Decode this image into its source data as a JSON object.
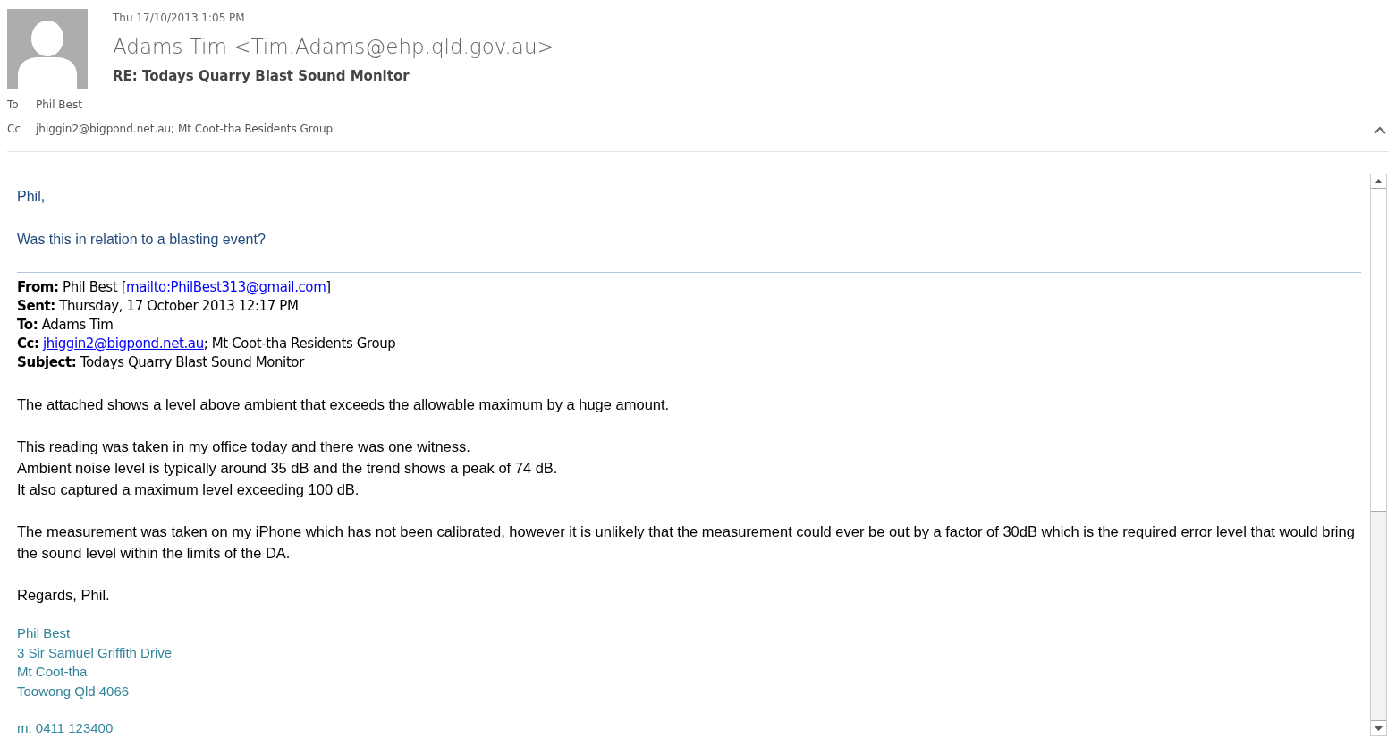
{
  "header": {
    "date": "Thu 17/10/2013 1:05 PM",
    "sender": "Adams Tim <Tim.Adams@ehp.qld.gov.au>",
    "subject": "RE: Todays Quarry Blast Sound Monitor",
    "recipients": [
      {
        "label": "To",
        "value": "Phil Best"
      },
      {
        "label": "Cc",
        "value": "jhiggin2@bigpond.net.au; Mt Coot-tha Residents Group"
      }
    ]
  },
  "reply": [
    "Phil,",
    "Was this in relation to a blasting event?"
  ],
  "quoted_header": [
    {
      "label": "From:",
      "parts": [
        {
          "kind": "text",
          "text": "Phil Best ["
        },
        {
          "kind": "link",
          "text": "mailto:PhilBest313@gmail.com"
        },
        {
          "kind": "text",
          "text": "]"
        }
      ]
    },
    {
      "label": "Sent:",
      "parts": [
        {
          "kind": "text",
          "text": "Thursday, 17 October 2013 12:17 PM"
        }
      ]
    },
    {
      "label": "To:",
      "parts": [
        {
          "kind": "text",
          "text": "Adams Tim"
        }
      ]
    },
    {
      "label": "Cc:",
      "parts": [
        {
          "kind": "link",
          "text": "jhiggin2@bigpond.net.au"
        },
        {
          "kind": "text",
          "text": "; Mt Coot-tha Residents Group"
        }
      ]
    },
    {
      "label": "Subject:",
      "parts": [
        {
          "kind": "text",
          "text": "Todays Quarry Blast Sound Monitor"
        }
      ]
    }
  ],
  "quoted_body": [
    [
      "The attached shows a level above ambient that exceeds the allowable maximum by a huge amount."
    ],
    [
      "This reading was taken in my office today and there was one witness.",
      "Ambient noise level is typically around 35 dB and the trend shows a peak of 74 dB.",
      "It also captured a maximum level exceeding 100 dB."
    ],
    [
      "The measurement was taken on my iPhone which has not been calibrated, however it is unlikely that the measurement could ever be out by a factor of 30dB which is the required error level that would bring the sound level within the limits of the DA."
    ],
    [
      "Regards, Phil."
    ]
  ],
  "signature": [
    [
      "Phil Best",
      "3 Sir Samuel Griffith Drive",
      "Mt Coot-tha",
      "Toowong Qld 4066"
    ],
    [
      "m: 0411 123400"
    ]
  ]
}
